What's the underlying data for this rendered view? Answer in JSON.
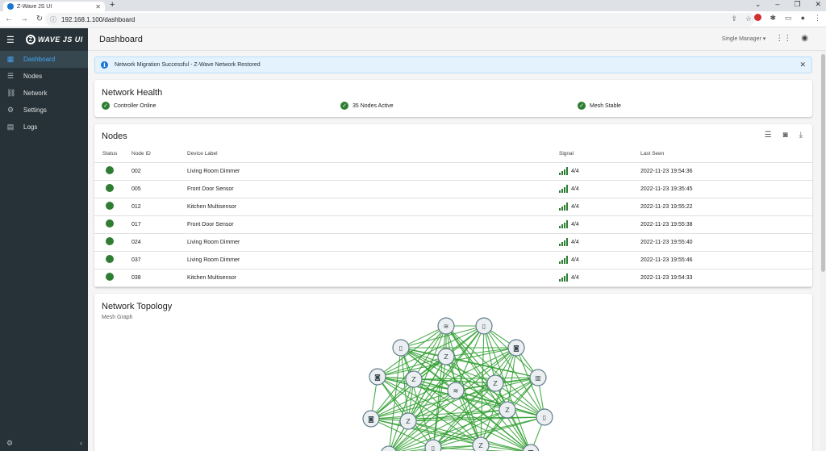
{
  "browser": {
    "tab_title": "Z-Wave JS UI",
    "new_tab": "+",
    "url": "192.168.1.100/dashboard"
  },
  "sidebar": {
    "logo_mark": "Z",
    "logo_text": "WAVE JS UI",
    "items": [
      {
        "label": "Dashboard",
        "icon": "dashboard-icon",
        "active": true
      },
      {
        "label": "Nodes",
        "icon": "list-icon",
        "active": false
      },
      {
        "label": "Network",
        "icon": "network-icon",
        "active": false
      },
      {
        "label": "Settings",
        "icon": "gear-icon",
        "active": false
      },
      {
        "label": "Logs",
        "icon": "document-icon",
        "active": false
      }
    ]
  },
  "appbar": {
    "title": "Dashboard",
    "menu_label": "Single Manager"
  },
  "alert": {
    "message": "Network Migration Successful - Z-Wave Network Restored",
    "color": "#e3f2fd"
  },
  "health": {
    "title": "Network Health",
    "stats": [
      {
        "label": "Controller Online"
      },
      {
        "label": "35 Nodes Active"
      },
      {
        "label": "Mesh Stable"
      }
    ]
  },
  "nodes": {
    "title": "Nodes",
    "columns": [
      "Status",
      "Node ID",
      "Device Label",
      "Signal",
      "Last Seen"
    ],
    "rows": [
      {
        "id": "002",
        "label": "Living Room Dimmer",
        "signal": "4/4",
        "last_seen": "2022-11-23 19:54:36"
      },
      {
        "id": "005",
        "label": "Front Door Sensor",
        "signal": "4/4",
        "last_seen": "2022-11-23 19:35:45"
      },
      {
        "id": "012",
        "label": "Kitchen Multisensor",
        "signal": "4/4",
        "last_seen": "2022-11-23 19:55:22"
      },
      {
        "id": "017",
        "label": "Front Door Sensor",
        "signal": "4/4",
        "last_seen": "2022-11-23 19:55:38"
      },
      {
        "id": "024",
        "label": "Living Room Dimmer",
        "signal": "4/4",
        "last_seen": "2022-11-23 19:55:40"
      },
      {
        "id": "037",
        "label": "Living Room Dimmer",
        "signal": "4/4",
        "last_seen": "2022-11-23 19:55:46"
      },
      {
        "id": "038",
        "label": "Kitchen Multisensor",
        "signal": "4/4",
        "last_seen": "2022-11-23 19:54:33"
      }
    ]
  },
  "topology": {
    "title": "Network Topology",
    "subtitle": "Mesh Graph",
    "link_color": "#2e9e2e"
  },
  "colors": {
    "status_green": "#2e7d32",
    "sidebar_bg": "#263238",
    "accent": "#42a5f5"
  }
}
